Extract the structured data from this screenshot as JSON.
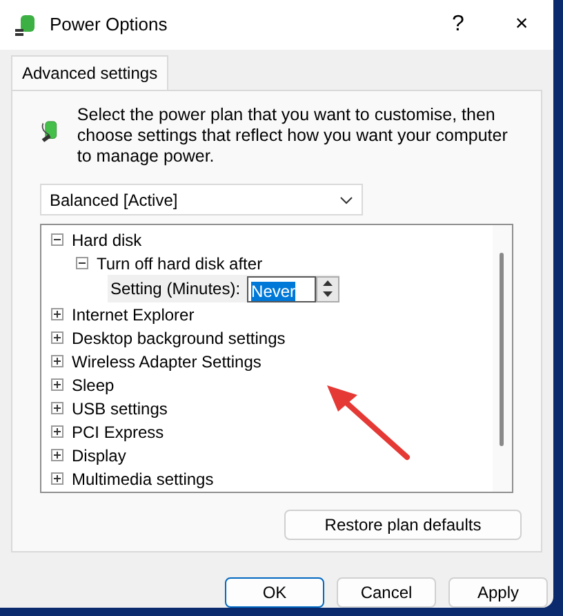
{
  "window": {
    "title": "Power Options",
    "help": "?",
    "close": "×"
  },
  "tabs": [
    {
      "label": "Advanced settings",
      "selected": true
    }
  ],
  "description": "Select the power plan that you want to customise, then choose settings that reflect how you want your computer to manage power.",
  "plan_dropdown": {
    "value": "Balanced [Active]"
  },
  "tree": [
    {
      "label": "Hard disk",
      "expanded": true,
      "children": [
        {
          "label": "Turn off hard disk after",
          "expanded": true,
          "setting": {
            "label": "Setting (Minutes):",
            "value": "Never",
            "selected": true
          }
        }
      ]
    },
    {
      "label": "Internet Explorer",
      "expanded": false
    },
    {
      "label": "Desktop background settings",
      "expanded": false
    },
    {
      "label": "Wireless Adapter Settings",
      "expanded": false
    },
    {
      "label": "Sleep",
      "expanded": false
    },
    {
      "label": "USB settings",
      "expanded": false
    },
    {
      "label": "PCI Express",
      "expanded": false
    },
    {
      "label": "Display",
      "expanded": false
    },
    {
      "label": "Multimedia settings",
      "expanded": false
    }
  ],
  "restore_button": "Restore plan defaults",
  "buttons": [
    {
      "label": "OK",
      "selected": true
    },
    {
      "label": "Cancel",
      "selected": false
    },
    {
      "label": "Apply",
      "selected": false
    }
  ]
}
